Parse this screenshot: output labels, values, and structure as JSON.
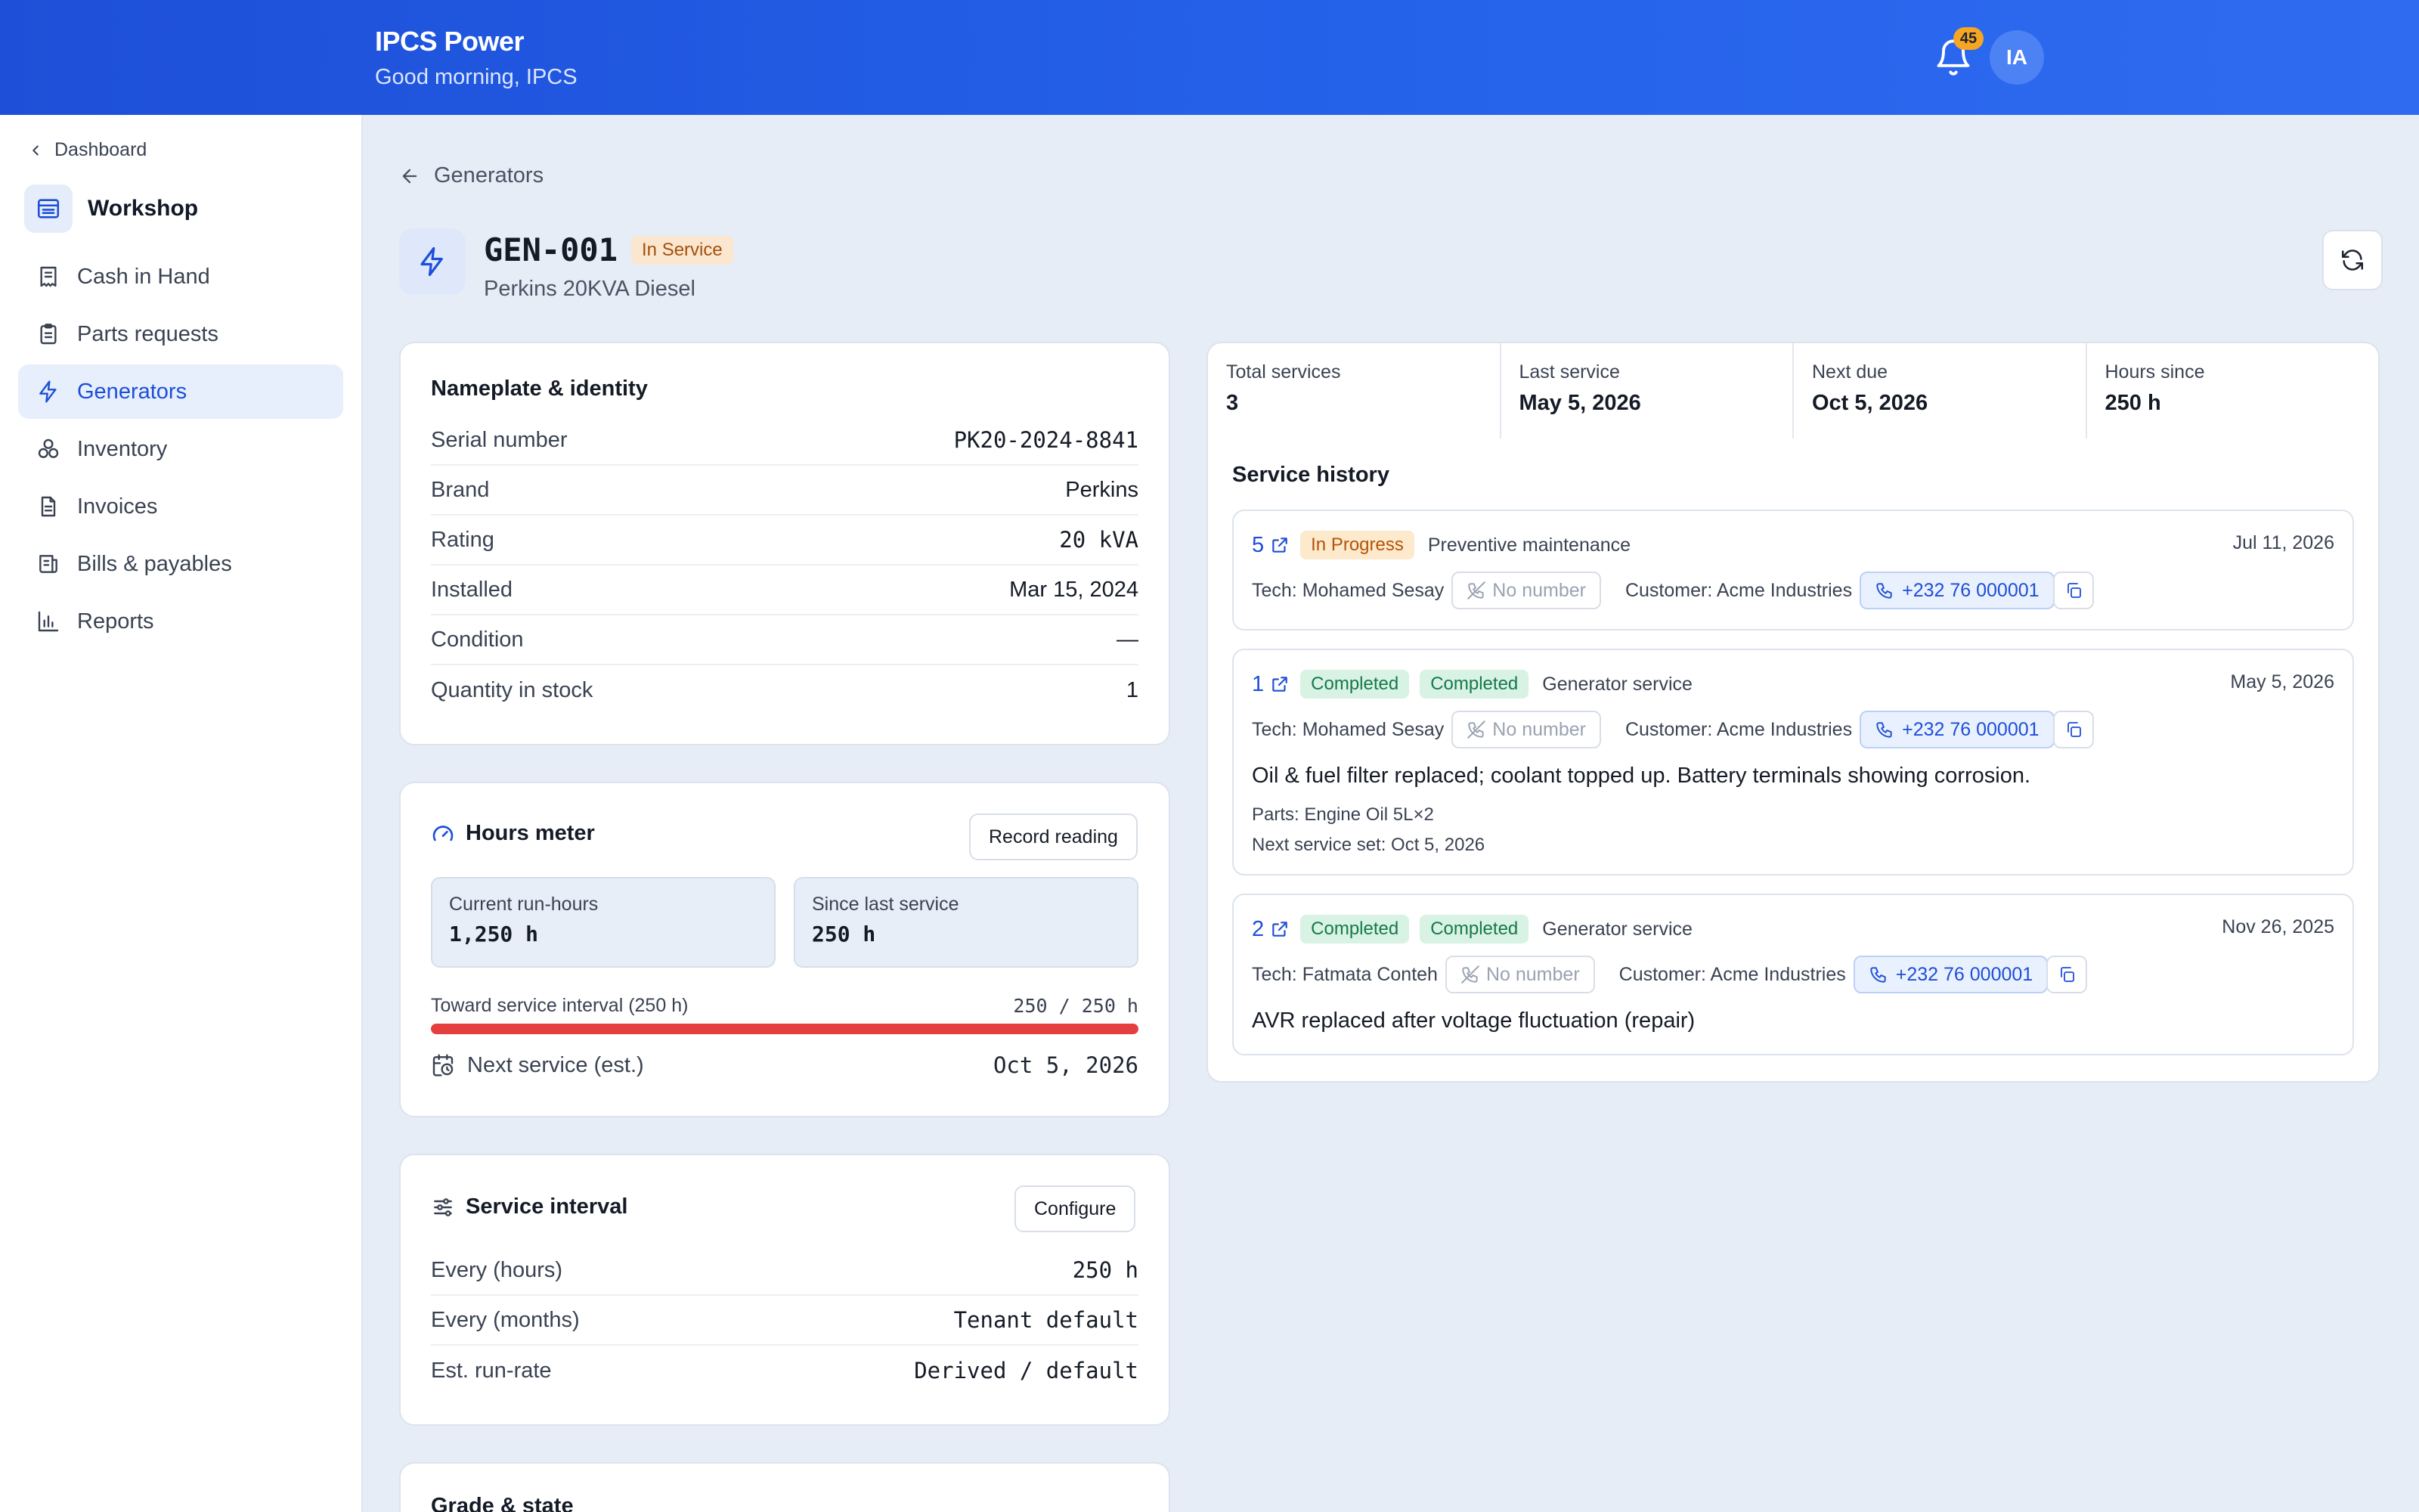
{
  "header": {
    "brand": "IPCS Power",
    "greeting": "Good morning, IPCS",
    "notifications": "45",
    "avatar": "IA"
  },
  "sidebar": {
    "back": "Dashboard",
    "section": "Workshop",
    "items": [
      {
        "label": "Cash in Hand",
        "icon": "receipt-icon"
      },
      {
        "label": "Parts requests",
        "icon": "clipboard-icon"
      },
      {
        "label": "Generators",
        "icon": "bolt-icon",
        "active": true
      },
      {
        "label": "Inventory",
        "icon": "boxes-icon"
      },
      {
        "label": "Invoices",
        "icon": "document-icon"
      },
      {
        "label": "Bills & payables",
        "icon": "bill-icon"
      },
      {
        "label": "Reports",
        "icon": "bar-chart-icon"
      }
    ]
  },
  "page": {
    "breadcrumb": "Generators",
    "code": "GEN-001",
    "status": "In Service",
    "model": "Perkins 20KVA Diesel"
  },
  "nameplate": {
    "title": "Nameplate & identity",
    "rows": [
      {
        "k": "Serial number",
        "v": "PK20-2024-8841"
      },
      {
        "k": "Brand",
        "v": "Perkins"
      },
      {
        "k": "Rating",
        "v": "20 kVA"
      },
      {
        "k": "Installed",
        "v": "Mar 15, 2024"
      },
      {
        "k": "Condition",
        "v": "—"
      },
      {
        "k": "Quantity in stock",
        "v": "1"
      }
    ]
  },
  "hours": {
    "title": "Hours meter",
    "button": "Record reading",
    "current_label": "Current run-hours",
    "current_value": "1,250 h",
    "since_label": "Since last service",
    "since_value": "250 h",
    "progress_label": "Toward service interval (250 h)",
    "progress_value": "250 / 250 h",
    "progress_fraction": 1.0,
    "next_label": "Next service (est.)",
    "next_value": "Oct 5, 2026"
  },
  "interval": {
    "title": "Service interval",
    "button": "Configure",
    "rows": [
      {
        "k": "Every (hours)",
        "v": "250 h"
      },
      {
        "k": "Every (months)",
        "v": "Tenant default"
      },
      {
        "k": "Est. run-rate",
        "v": "Derived / default"
      }
    ]
  },
  "grade": {
    "title": "Grade & state"
  },
  "stats": [
    {
      "label": "Total services",
      "value": "3"
    },
    {
      "label": "Last service",
      "value": "May 5, 2026"
    },
    {
      "label": "Next due",
      "value": "Oct 5, 2026"
    },
    {
      "label": "Hours since",
      "value": "250 h"
    }
  ],
  "history": {
    "title": "Service history",
    "services": [
      {
        "num": "5",
        "statuses": [
          "In Progress"
        ],
        "type": "Preventive maintenance",
        "date": "Jul 11, 2026",
        "tech": "Tech: Mohamed Sesay",
        "no_number": "No number",
        "customer": "Customer: Acme Industries",
        "phone": "+232 76 000001"
      },
      {
        "num": "1",
        "statuses": [
          "Completed",
          "Completed"
        ],
        "type": "Generator service",
        "date": "May 5, 2026",
        "tech": "Tech: Mohamed Sesay",
        "no_number": "No number",
        "customer": "Customer: Acme Industries",
        "phone": "+232 76 000001",
        "note": "Oil & fuel filter replaced; coolant topped up. Battery terminals showing corrosion.",
        "parts": "Parts: Engine Oil 5L×2",
        "next_set": "Next service set: Oct 5, 2026"
      },
      {
        "num": "2",
        "statuses": [
          "Completed",
          "Completed"
        ],
        "type": "Generator service",
        "date": "Nov 26, 2025",
        "tech": "Tech: Fatmata Conteh",
        "no_number": "No number",
        "customer": "Customer: Acme Industries",
        "phone": "+232 76 000001",
        "note": "AVR replaced after voltage fluctuation (repair)"
      }
    ]
  },
  "colors": {
    "header": "#2563eb",
    "accent": "#1d4ed8",
    "progress": "#e53e3e",
    "badge_progress": "#b45309",
    "badge_done": "#16794a"
  }
}
